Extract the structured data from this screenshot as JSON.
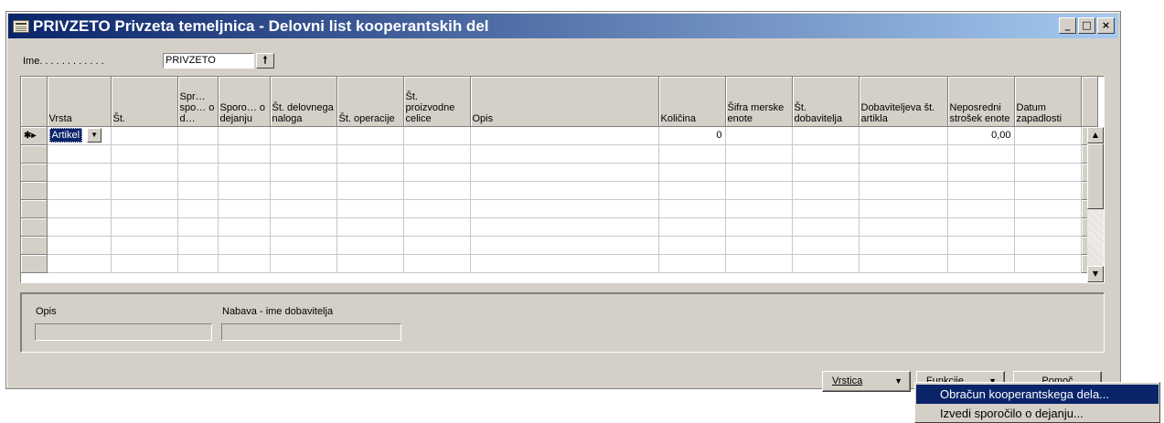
{
  "window": {
    "title": "PRIVZETO Privzeta temeljnica - Delovni list kooperantskih del",
    "controls": [
      "_",
      "□",
      "×"
    ]
  },
  "ime": {
    "label": "Ime. . . . . . . . . . . .",
    "value": "PRIVZETO",
    "lookup_icon": "lookup-arrow-icon"
  },
  "table": {
    "headers": [
      "Vrsta",
      "Št.",
      "Spr… spo… o d…",
      "Sporo… o dejanju",
      "Št. delovnega naloga",
      "Št. operacije",
      "Št. proizvodne celice",
      "Opis",
      "Količina",
      "Šifra merske enote",
      "Št. dobavitelja",
      "Dobaviteljeva št. artikla",
      "Neposredni strošek enote",
      "Datum zapadlosti"
    ],
    "row_marker": "✱▸",
    "current_row": {
      "vrsta": "Artikel",
      "kolicina": "0",
      "neposredni_strosek": "0,00"
    }
  },
  "info": {
    "opis_label": "Opis",
    "nabava_label": "Nabava - ime dobavitelja"
  },
  "buttons": {
    "vrstica": "Vrstica",
    "funkcije": "Funkcije",
    "pomoc": "Pomoč"
  },
  "menu": {
    "items": [
      "Obračun kooperantskega dela...",
      "Izvedi sporočilo o dejanju..."
    ],
    "highlighted_index": 0
  },
  "colors": {
    "title_start": "#0a246a",
    "title_end": "#a6caf0",
    "face": "#d4d0c8",
    "highlight": "#0a246a"
  }
}
